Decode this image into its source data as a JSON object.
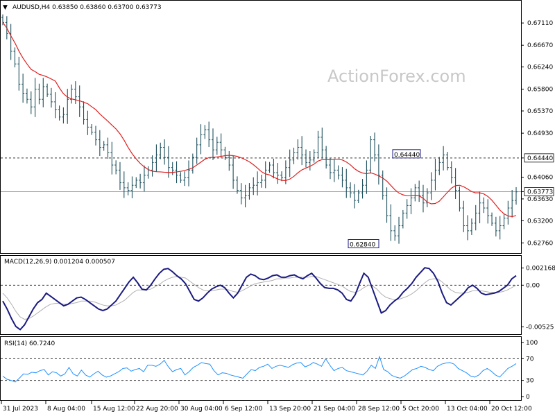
{
  "header": {
    "main": "AUDUSD,H4  0.63850 0.63860 0.63700 0.63773",
    "macd": "MACD(12,26,9) 0.001204 0.000507",
    "rsi": "RSI(14) 60.7240"
  },
  "watermark": "ActionForex.com",
  "colors": {
    "candle": "#1c4f5c",
    "ma": "#e02020",
    "macd_line": "#1a1a80",
    "macd_signal": "#b0b0b0",
    "rsi": "#1e90ff",
    "grid": "#000000"
  },
  "chart_data": [
    {
      "type": "candlestick",
      "title": "AUDUSD,H4",
      "ohlc_last": {
        "open": 0.6385,
        "high": 0.6386,
        "low": 0.637,
        "close": 0.63773
      },
      "ylim": [
        0.626,
        0.674
      ],
      "y_ticks": [
        "0.67110",
        "0.66670",
        "0.66240",
        "0.65800",
        "0.65370",
        "0.64930",
        "0.64440",
        "0.64060",
        "0.63773",
        "0.63630",
        "0.63200",
        "0.62760"
      ],
      "y_tick_values": [
        0.6711,
        0.6667,
        0.6624,
        0.658,
        0.6537,
        0.6493,
        0.6444,
        0.6406,
        0.63773,
        0.6363,
        0.632,
        0.6276
      ],
      "x_ticks": [
        "31 Jul 2023",
        "8 Aug 04:00",
        "15 Aug 12:00",
        "22 Aug 20:00",
        "30 Aug 04:00",
        "6 Sep 12:00",
        "13 Sep 20:00",
        "21 Sep 04:00",
        "28 Sep 12:00",
        "5 Oct 20:00",
        "13 Oct 04:00",
        "20 Oct 12:00"
      ],
      "annotations": [
        {
          "label": "0.64440",
          "value": 0.6444
        },
        {
          "label": "0.62840",
          "value": 0.6284
        }
      ],
      "horizontal_lines": [
        0.6444,
        0.63773
      ],
      "close_series": [
        0.6712,
        0.669,
        0.6655,
        0.663,
        0.659,
        0.6572,
        0.656,
        0.6545,
        0.658,
        0.656,
        0.6585,
        0.657,
        0.6555,
        0.654,
        0.6525,
        0.653,
        0.656,
        0.658,
        0.6565,
        0.6545,
        0.652,
        0.6505,
        0.6495,
        0.648,
        0.6465,
        0.647,
        0.6455,
        0.643,
        0.642,
        0.6395,
        0.6385,
        0.638,
        0.639,
        0.64,
        0.6395,
        0.641,
        0.642,
        0.6435,
        0.645,
        0.6465,
        0.6445,
        0.6425,
        0.642,
        0.641,
        0.64,
        0.6405,
        0.642,
        0.6445,
        0.647,
        0.649,
        0.65,
        0.648,
        0.646,
        0.6475,
        0.646,
        0.6445,
        0.643,
        0.64,
        0.638,
        0.6365,
        0.637,
        0.6385,
        0.639,
        0.6395,
        0.64,
        0.642,
        0.643,
        0.6415,
        0.641,
        0.6405,
        0.6425,
        0.644,
        0.6455,
        0.6465,
        0.645,
        0.6435,
        0.644,
        0.6455,
        0.6485,
        0.646,
        0.643,
        0.6415,
        0.642,
        0.641,
        0.64,
        0.6385,
        0.6375,
        0.636,
        0.6375,
        0.639,
        0.642,
        0.648,
        0.645,
        0.641,
        0.637,
        0.633,
        0.63,
        0.629,
        0.631,
        0.6335,
        0.635,
        0.6365,
        0.6385,
        0.637,
        0.6355,
        0.6375,
        0.64,
        0.642,
        0.6435,
        0.645,
        0.6425,
        0.6405,
        0.638,
        0.6345,
        0.631,
        0.63,
        0.6315,
        0.6335,
        0.6355,
        0.6345,
        0.633,
        0.6315,
        0.63,
        0.631,
        0.6325,
        0.6345,
        0.636,
        0.6377
      ]
    },
    {
      "type": "line",
      "title": "MACD(12,26,9)",
      "values_text": [
        "0.001204",
        "0.000507"
      ],
      "y_ticks": [
        "0.002168",
        "0.00",
        "-0.00525"
      ],
      "y_tick_values": [
        0.002168,
        0.0,
        -0.00525
      ],
      "ylim": [
        -0.006,
        0.003
      ],
      "series": [
        {
          "name": "MACD",
          "values": [
            -0.002,
            -0.003,
            -0.0042,
            -0.0052,
            -0.0056,
            -0.005,
            -0.004,
            -0.003,
            -0.0022,
            -0.0018,
            -0.001,
            -0.0014,
            -0.0018,
            -0.0022,
            -0.0026,
            -0.0024,
            -0.002,
            -0.0016,
            -0.0015,
            -0.0018,
            -0.0022,
            -0.0026,
            -0.003,
            -0.0032,
            -0.003,
            -0.0025,
            -0.002,
            -0.0012,
            -0.0004,
            0.0004,
            0.001,
            0.0003,
            -0.0005,
            -0.0006,
            0.0,
            0.0008,
            0.0015,
            0.002,
            0.0021,
            0.0017,
            0.0012,
            0.0008,
            0.0002,
            -0.0008,
            -0.0018,
            -0.002,
            -0.0016,
            -0.001,
            -0.0005,
            -0.0002,
            0.0,
            -0.0003,
            -0.001,
            -0.0016,
            -0.001,
            0.0,
            0.001,
            0.0014,
            0.0012,
            0.0008,
            0.0007,
            0.0009,
            0.0012,
            0.0013,
            0.001,
            0.001,
            0.0012,
            0.0013,
            0.001,
            0.0008,
            0.0012,
            0.0015,
            0.0009,
            0.0002,
            -0.0003,
            -0.0004,
            -0.0004,
            -0.0006,
            -0.001,
            -0.0018,
            -0.002,
            -0.0012,
            0.0002,
            0.0015,
            0.001,
            -0.0005,
            -0.002,
            -0.0035,
            -0.0032,
            -0.0025,
            -0.002,
            -0.0016,
            -0.0009,
            -0.0004,
            0.0002,
            0.001,
            0.0016,
            0.0022,
            0.0021,
            0.0015,
            0.0005,
            -0.001,
            -0.0022,
            -0.0025,
            -0.002,
            -0.0015,
            -0.001,
            -0.0003,
            0.0,
            -0.0004,
            -0.001,
            -0.0012,
            -0.0011,
            -0.001,
            -0.0008,
            -0.0004,
            0.0,
            0.0008,
            0.0012
          ]
        },
        {
          "name": "Signal",
          "values": [
            -0.001,
            -0.0016,
            -0.0024,
            -0.0033,
            -0.004,
            -0.0043,
            -0.0042,
            -0.0039,
            -0.0035,
            -0.0031,
            -0.0027,
            -0.0024,
            -0.0023,
            -0.0023,
            -0.0024,
            -0.0024,
            -0.0023,
            -0.0022,
            -0.002,
            -0.002,
            -0.002,
            -0.0021,
            -0.0023,
            -0.0025,
            -0.0026,
            -0.0026,
            -0.0025,
            -0.0022,
            -0.0019,
            -0.0014,
            -0.0009,
            -0.0006,
            -0.0006,
            -0.0006,
            -0.0005,
            -0.0002,
            0.0001,
            0.0005,
            0.0008,
            0.001,
            0.0011,
            0.001,
            0.0009,
            0.0005,
            0.0001,
            -0.0003,
            -0.0006,
            -0.0007,
            -0.0007,
            -0.0006,
            -0.0005,
            -0.0005,
            -0.0006,
            -0.0008,
            -0.0009,
            -0.0007,
            -0.0004,
            -0.0001,
            0.0002,
            0.0003,
            0.0004,
            0.0005,
            0.0006,
            0.0008,
            0.0008,
            0.0009,
            0.0009,
            0.001,
            0.001,
            0.001,
            0.001,
            0.0011,
            0.0011,
            0.0009,
            0.0007,
            0.0005,
            0.0003,
            0.0001,
            -0.0001,
            -0.0005,
            -0.0008,
            -0.0009,
            -0.0007,
            -0.0003,
            0.0,
            -0.0001,
            -0.0005,
            -0.0011,
            -0.0015,
            -0.0017,
            -0.0018,
            -0.0018,
            -0.0016,
            -0.0014,
            -0.0011,
            -0.0007,
            -0.0002,
            0.0003,
            0.0007,
            0.0008,
            0.0008,
            0.0004,
            -0.0001,
            -0.0006,
            -0.0009,
            -0.001,
            -0.001,
            -0.0009,
            -0.0007,
            -0.0007,
            -0.0007,
            -0.0008,
            -0.0009,
            -0.0009,
            -0.0009,
            -0.0008,
            -0.0006,
            -0.0003,
            0.0
          ]
        }
      ]
    },
    {
      "type": "line",
      "title": "RSI(14)",
      "value_text": "60.7240",
      "y_ticks": [
        "100",
        "70",
        "30",
        "0"
      ],
      "y_tick_values": [
        100,
        70,
        30,
        0
      ],
      "ylim": [
        0,
        100
      ],
      "levels": [
        70,
        30
      ],
      "series": [
        {
          "name": "RSI",
          "values": [
            38,
            32,
            30,
            27,
            34,
            42,
            41,
            45,
            44,
            48,
            50,
            40,
            46,
            44,
            38,
            42,
            54,
            42,
            38,
            49,
            40,
            36,
            42,
            47,
            40,
            36,
            38,
            42,
            46,
            52,
            53,
            47,
            50,
            52,
            46,
            58,
            58,
            56,
            60,
            67,
            55,
            46,
            50,
            52,
            40,
            46,
            54,
            58,
            63,
            61,
            60,
            48,
            40,
            44,
            43,
            40,
            38,
            36,
            34,
            42,
            50,
            48,
            54,
            56,
            60,
            52,
            56,
            58,
            56,
            54,
            59,
            62,
            63,
            55,
            58,
            63,
            60,
            56,
            70,
            58,
            48,
            52,
            54,
            48,
            46,
            44,
            42,
            40,
            47,
            58,
            52,
            74,
            50,
            46,
            39,
            36,
            34,
            38,
            44,
            50,
            52,
            56,
            54,
            50,
            48,
            56,
            60,
            62,
            63,
            60,
            52,
            48,
            44,
            38,
            36,
            40,
            48,
            52,
            47,
            40,
            36,
            44,
            52,
            56,
            61
          ]
        }
      ]
    }
  ]
}
